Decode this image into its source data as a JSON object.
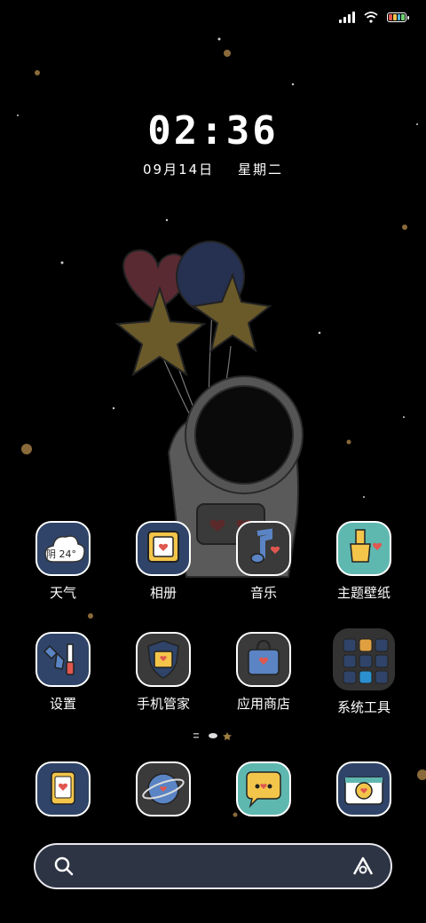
{
  "status_bar": {
    "signal": "signal-icon",
    "wifi": "wifi-icon",
    "battery": "battery-icon"
  },
  "lockclock": {
    "time": "02:36",
    "date": "09月14日",
    "weekday": "星期二"
  },
  "apps_row1": [
    {
      "name": "天气",
      "icon": "weather-icon",
      "badge": "阴 24°"
    },
    {
      "name": "相册",
      "icon": "gallery-icon"
    },
    {
      "name": "音乐",
      "icon": "music-icon"
    },
    {
      "name": "主题壁纸",
      "icon": "theme-wallpaper-icon"
    }
  ],
  "apps_row2": [
    {
      "name": "设置",
      "icon": "settings-icon"
    },
    {
      "name": "手机管家",
      "icon": "security-icon"
    },
    {
      "name": "应用商店",
      "icon": "app-store-icon"
    },
    {
      "name": "系统工具",
      "icon": "folder-icon"
    }
  ],
  "dock": [
    {
      "icon": "phone-icon"
    },
    {
      "icon": "browser-icon"
    },
    {
      "icon": "messages-icon"
    },
    {
      "icon": "camera-icon"
    }
  ],
  "search": {
    "search_icon": "search-icon",
    "assistant_icon": "assistant-icon"
  }
}
